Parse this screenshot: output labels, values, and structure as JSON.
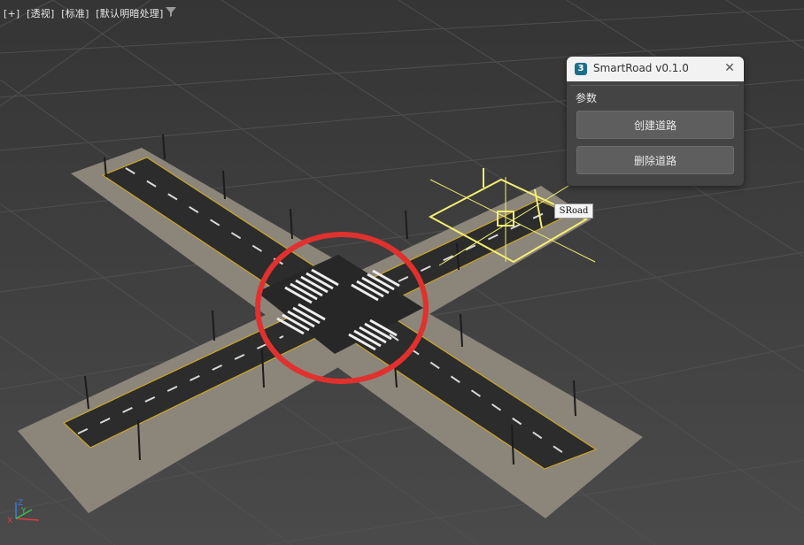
{
  "viewport": {
    "labels": [
      "[+]",
      "[透视]",
      "[标准]",
      "[默认明暗处理]"
    ],
    "filter_icon": "funnel-icon",
    "object_tag": "SRoad",
    "axis": {
      "x": "X",
      "y": "Y",
      "z": "Z"
    }
  },
  "panel": {
    "title": "SmartRoad v0.1.0",
    "app_icon_glyph": "3",
    "group_label": "参数",
    "create_button": "创建道路",
    "delete_button": "删除道路",
    "close_icon": "close-icon"
  },
  "colors": {
    "viewport_bg": "#3d3d3d",
    "sidewalk": "#8c857a",
    "asphalt": "#2b2c2b",
    "selection": "#f3ef72",
    "highlight_circle": "#e0312e"
  }
}
